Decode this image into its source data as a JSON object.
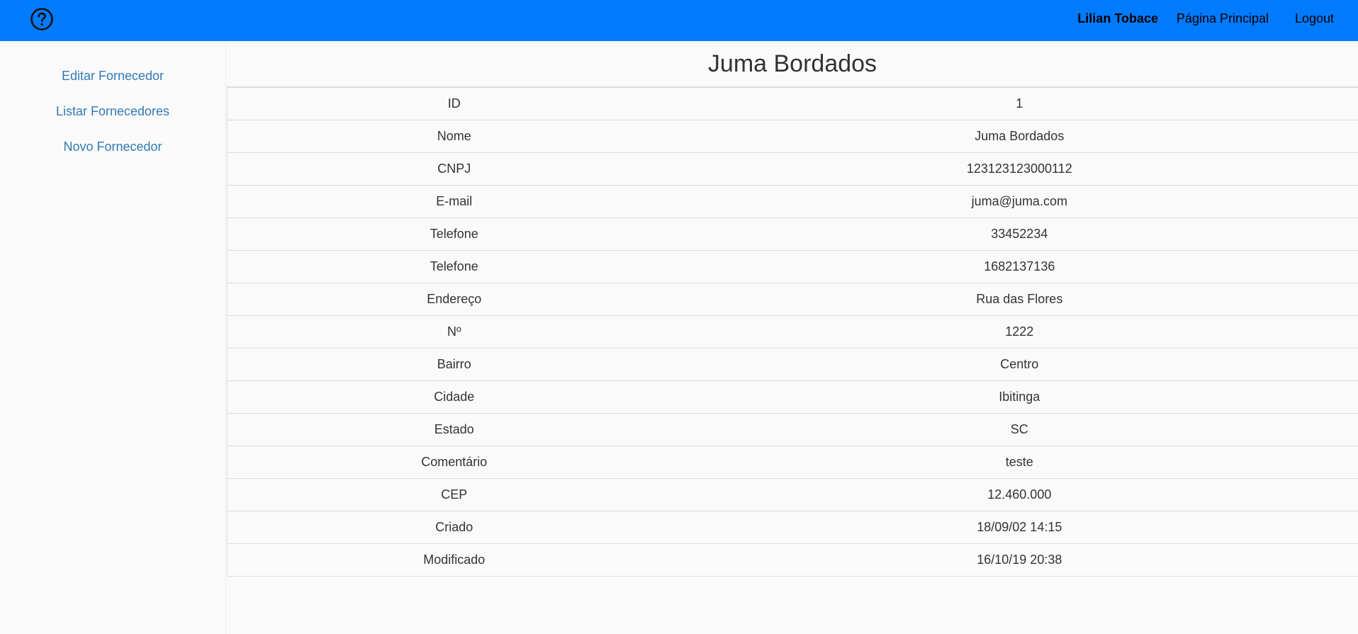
{
  "header": {
    "user_name": "Lilian Tobace",
    "home_link": "Página Principal",
    "logout_link": "Logout",
    "help_icon": "help-circle-icon",
    "bar_color": "#007bff"
  },
  "sidebar": {
    "items": [
      {
        "label": "Editar Fornecedor"
      },
      {
        "label": "Listar Fornecedores"
      },
      {
        "label": "Novo Fornecedor"
      }
    ],
    "link_color": "#337ab7"
  },
  "main": {
    "title": "Juma Bordados",
    "rows": [
      {
        "label": "ID",
        "value": "1"
      },
      {
        "label": "Nome",
        "value": "Juma Bordados"
      },
      {
        "label": "CNPJ",
        "value": "123123123000112"
      },
      {
        "label": "E-mail",
        "value": "juma@juma.com"
      },
      {
        "label": "Telefone",
        "value": "33452234"
      },
      {
        "label": "Telefone",
        "value": "1682137136"
      },
      {
        "label": "Endereço",
        "value": "Rua das Flores"
      },
      {
        "label": "Nº",
        "value": "1222"
      },
      {
        "label": "Bairro",
        "value": "Centro"
      },
      {
        "label": "Cidade",
        "value": "Ibitinga"
      },
      {
        "label": "Estado",
        "value": "SC"
      },
      {
        "label": "Comentário",
        "value": "teste"
      },
      {
        "label": "CEP",
        "value": "12.460.000"
      },
      {
        "label": "Criado",
        "value": "18/09/02 14:15"
      },
      {
        "label": "Modificado",
        "value": "16/10/19 20:38"
      }
    ]
  }
}
